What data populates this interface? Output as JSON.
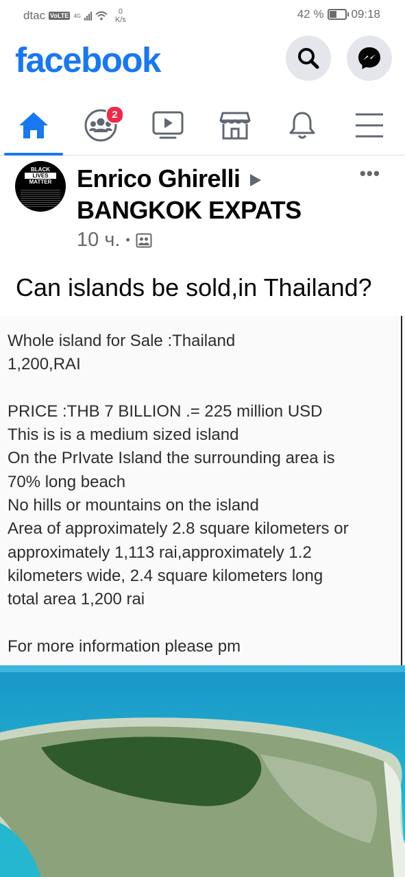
{
  "status_bar": {
    "carrier": "dtac",
    "volte": "VoLTE",
    "network": "4G",
    "speed_value": "0",
    "speed_unit": "K/s",
    "battery": "42 %",
    "time": "09:18"
  },
  "header": {
    "logo": "facebook",
    "search_icon": "search-icon",
    "messenger_icon": "messenger-icon"
  },
  "tabs": [
    {
      "name": "home",
      "icon": "home-icon",
      "active": true
    },
    {
      "name": "groups",
      "icon": "groups-icon",
      "badge": "2"
    },
    {
      "name": "watch",
      "icon": "video-icon"
    },
    {
      "name": "marketplace",
      "icon": "marketplace-icon"
    },
    {
      "name": "notifications",
      "icon": "bell-icon"
    },
    {
      "name": "menu",
      "icon": "hamburger-icon"
    }
  ],
  "post": {
    "avatar_text": [
      "BLACK",
      "LIVES",
      "MATTER"
    ],
    "author": "Enrico Ghirelli",
    "group": "BANGKOK EXPATS",
    "time": "10 ч.",
    "separator": "•",
    "privacy_icon": "group-privacy-icon",
    "caption": "Can islands be sold,in Thailand?",
    "photo_text": "Whole island for Sale :Thailand\n1,200,RAI\n\nPRICE :THB 7 BILLION .= 225 million USD\nThis is is a medium sized island\nOn the PrIvate Island the surrounding area is\n70% long beach\nNo hills or mountains on the island\nArea of approximately 2.8 square kilometers or\napproximately 1,113 rai,approximately 1.2\nkilometers wide, 2.4 square kilometers long\ntotal area 1,200 rai\n\nFor more information please pm"
  },
  "colors": {
    "brand": "#1877f2",
    "badge": "#f02849",
    "icon_gray": "#606770"
  }
}
